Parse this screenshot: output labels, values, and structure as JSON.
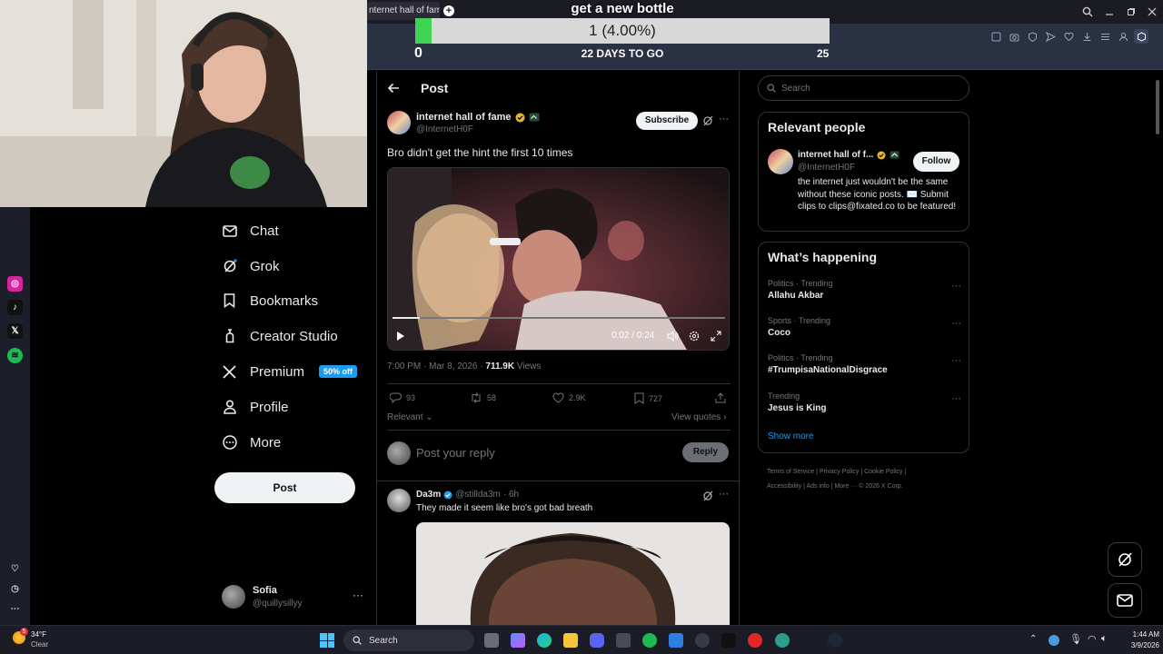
{
  "browser": {
    "tab_title": "nternet hall of fame o",
    "new_tab": "+"
  },
  "overlay": {
    "title": "get a new bottle",
    "progress_text": "1 (4.00%)",
    "progress_fraction": 0.04,
    "min": "0",
    "days_to_go": "22 DAYS TO GO",
    "max": "25"
  },
  "nav": {
    "items": [
      {
        "label": "Chat",
        "icon": "envelope-icon"
      },
      {
        "label": "Grok",
        "icon": "grok-icon"
      },
      {
        "label": "Bookmarks",
        "icon": "bookmark-icon"
      },
      {
        "label": "Creator Studio",
        "icon": "flask-icon"
      },
      {
        "label": "Premium",
        "icon": "x-logo-icon"
      },
      {
        "label": "Profile",
        "icon": "person-icon"
      },
      {
        "label": "More",
        "icon": "more-circle-icon"
      }
    ],
    "premium_badge": "50% off",
    "post_button": "Post",
    "account": {
      "name": "Sofia",
      "handle": "@quillysillyy",
      "more": "···"
    }
  },
  "post_page": {
    "header": "Post",
    "author": {
      "name": "internet hall of fame",
      "handle": "@InternetH0F"
    },
    "subscribe_label": "Subscribe",
    "text": "Bro didn't get the hint the first 10 times",
    "video": {
      "time": "0:02 / 0:24",
      "progress": 0.083
    },
    "meta": {
      "time": "7:00 PM · Mar 8, 2026 · ",
      "views_count": "711.9K",
      "views_label": " Views"
    },
    "actions": {
      "replies": "93",
      "reposts": "58",
      "likes": "2.9K",
      "bookmarks": "727"
    },
    "relevant_label": "Relevant",
    "view_quotes_label": "View quotes",
    "reply_placeholder": "Post your reply",
    "reply_button": "Reply"
  },
  "reply": {
    "name": "Da3m",
    "handle": "@stillda3m",
    "time": "· 6h",
    "text": "They made it seem like bro's got bad breath"
  },
  "sidebar": {
    "search_placeholder": "Search",
    "relevant_people": {
      "title": "Relevant people",
      "name": "internet hall of f...",
      "handle": "@InternetH0F",
      "follow_label": "Follow",
      "bio": "the internet just wouldn't be the same without these iconic posts. ✉️ Submit clips to clips@fixated.co to be featured!"
    },
    "happening": {
      "title": "What’s happening",
      "trends": [
        {
          "category": "Politics · Trending",
          "name": "Allahu Akbar"
        },
        {
          "category": "Sports · Trending",
          "name": "Coco"
        },
        {
          "category": "Politics · Trending",
          "name": "#TrumpisaNationalDisgrace"
        },
        {
          "category": "Trending",
          "name": "Jesus is King"
        }
      ],
      "show_more": "Show more"
    },
    "footer": {
      "line1": "Terms of Service  |   Privacy Policy   |   Cookie Policy   |",
      "line2": "Accessibility   |   Ads info   |   More ···   © 2026 X Corp."
    }
  },
  "taskbar": {
    "weather_temp": "34°F",
    "weather_desc": "Clear",
    "weather_badge": "5",
    "search_label": "Search",
    "clock_time": "1:44 AM",
    "clock_date": "3/9/2026"
  },
  "colors": {
    "accent": "#1d9bf0",
    "goal_fill": "#3fd454",
    "background": "#000000"
  }
}
